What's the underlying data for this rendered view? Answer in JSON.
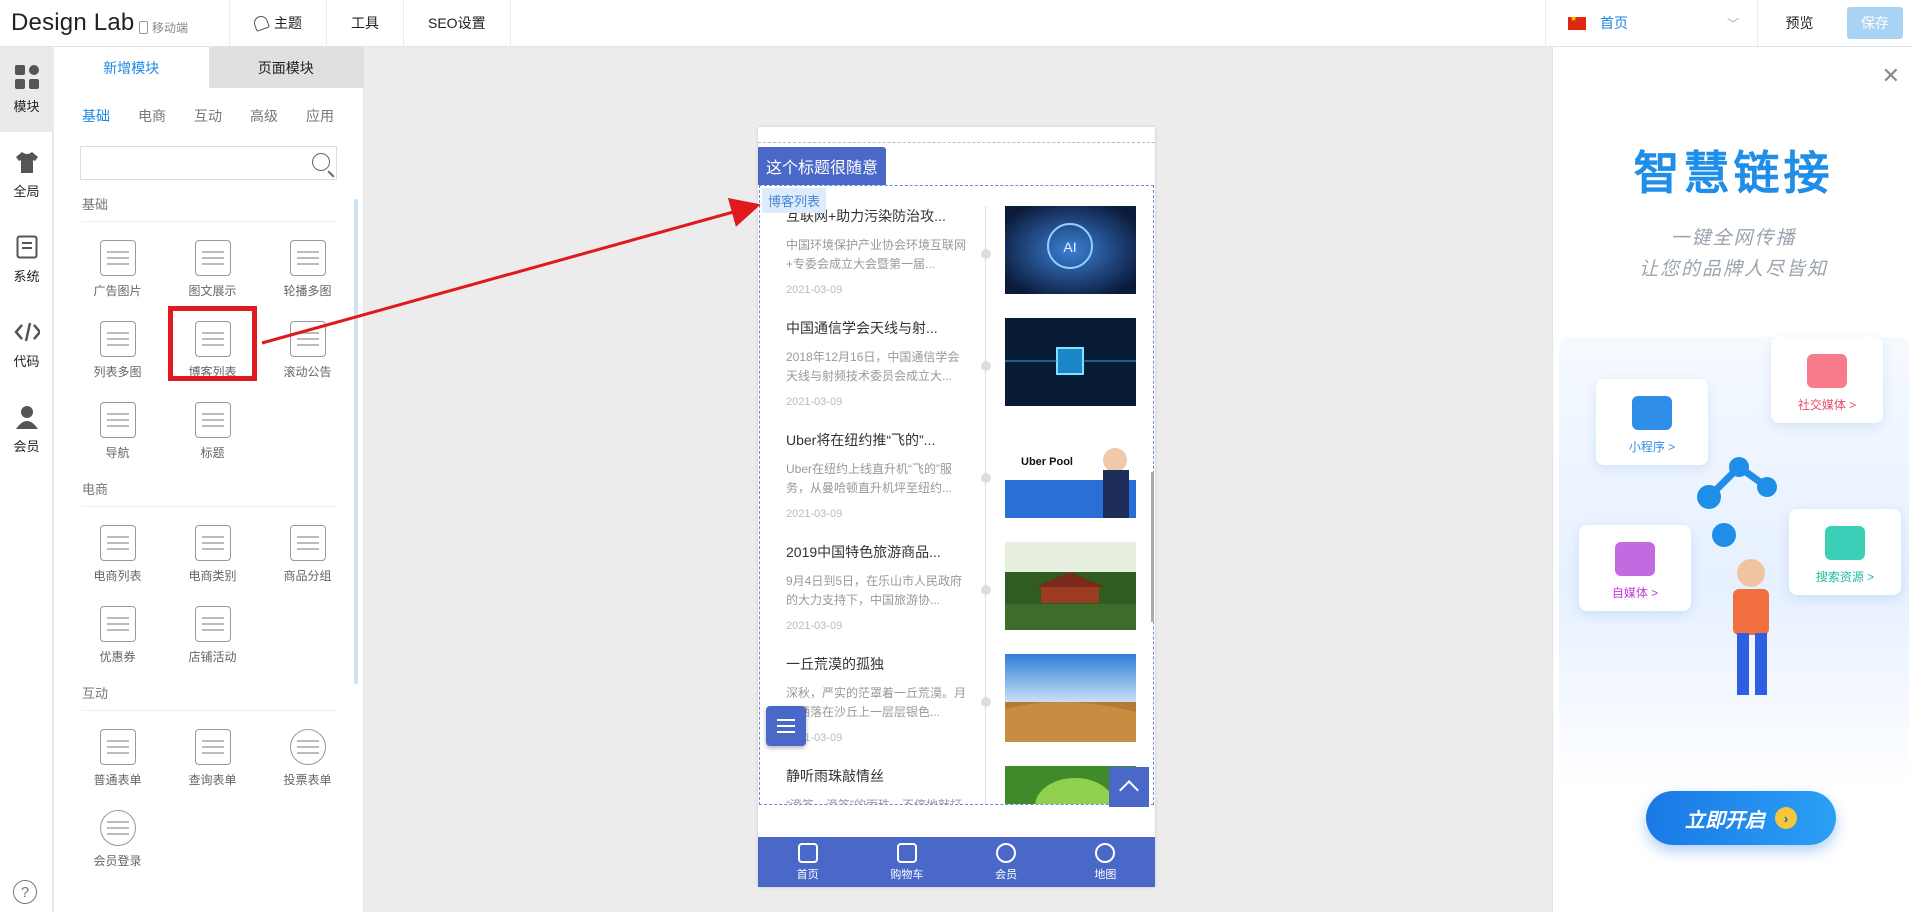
{
  "header": {
    "logo": "Design Lab",
    "mobile_label": "移动端",
    "nav": [
      "主题",
      "工具",
      "SEO设置"
    ],
    "page_select": "首页",
    "preview": "预览",
    "save": "保存"
  },
  "rail": {
    "items": [
      {
        "label": "模块",
        "icon": "modules-icon"
      },
      {
        "label": "全局",
        "icon": "shirt-icon"
      },
      {
        "label": "系统",
        "icon": "document-icon"
      },
      {
        "label": "代码",
        "icon": "code-icon"
      },
      {
        "label": "会员",
        "icon": "user-icon"
      }
    ],
    "help": "?"
  },
  "panel": {
    "tabs": [
      "新增模块",
      "页面模块"
    ],
    "subtabs": [
      "基础",
      "电商",
      "互动",
      "高级",
      "应用"
    ],
    "search_placeholder": "",
    "groups": [
      {
        "title": "基础",
        "modules": [
          "广告图片",
          "图文展示",
          "轮播多图",
          "列表多图",
          "博客列表",
          "滚动公告",
          "导航",
          "标题"
        ]
      },
      {
        "title": "电商",
        "modules": [
          "电商列表",
          "电商类别",
          "商品分组",
          "优惠券",
          "店铺活动"
        ]
      },
      {
        "title": "互动",
        "modules": [
          "普通表单",
          "查询表单",
          "投票表单",
          "会员登录"
        ]
      }
    ]
  },
  "phone": {
    "title": "这个标题很随意",
    "blog_label": "博客列表",
    "posts": [
      {
        "title": "互联网+助力污染防治攻...",
        "desc": "中国环境保护产业协会环境互联网+专委会成立大会暨第一届...",
        "date": "2021-03-09"
      },
      {
        "title": "中国通信学会天线与射...",
        "desc": "2018年12月16日，中国通信学会天线与射频技术委员会成立大...",
        "date": "2021-03-09"
      },
      {
        "title": "Uber将在纽约推“飞的”...",
        "desc": "Uber在纽约上线直升机“飞的”服务，从曼哈顿直升机坪至纽约...",
        "date": "2021-03-09"
      },
      {
        "title": "2019中国特色旅游商品...",
        "desc": "9月4日到5日，在乐山市人民政府的大力支持下，中国旅游协...",
        "date": "2021-03-09"
      },
      {
        "title": "一丘荒漠的孤独",
        "desc": "深秋，严实的茫罩着一丘荒漠。月光洒落在沙丘上一层层银色...",
        "date": "2021-03-09"
      },
      {
        "title": "静听雨珠敲情丝",
        "desc": "“滴答、滴答”的雨珠，不停地敲打着玻璃窗得窗玻，似妙曼的...",
        "date": ""
      }
    ],
    "image_text_3": "Uber Pool",
    "bottom_nav": [
      "首页",
      "购物车",
      "会员",
      "地图"
    ]
  },
  "ad": {
    "title": "智慧链接",
    "sub1": "一键全网传播",
    "sub2": "让您的品牌人尽皆知",
    "cards": [
      "小程序 >",
      "社交媒体 >",
      "自媒体 >",
      "搜索资源 >"
    ],
    "cta": "立即开启"
  },
  "colors": {
    "accent": "#1e88e5",
    "theme": "#4a68c7",
    "highlight": "#e0191c"
  }
}
